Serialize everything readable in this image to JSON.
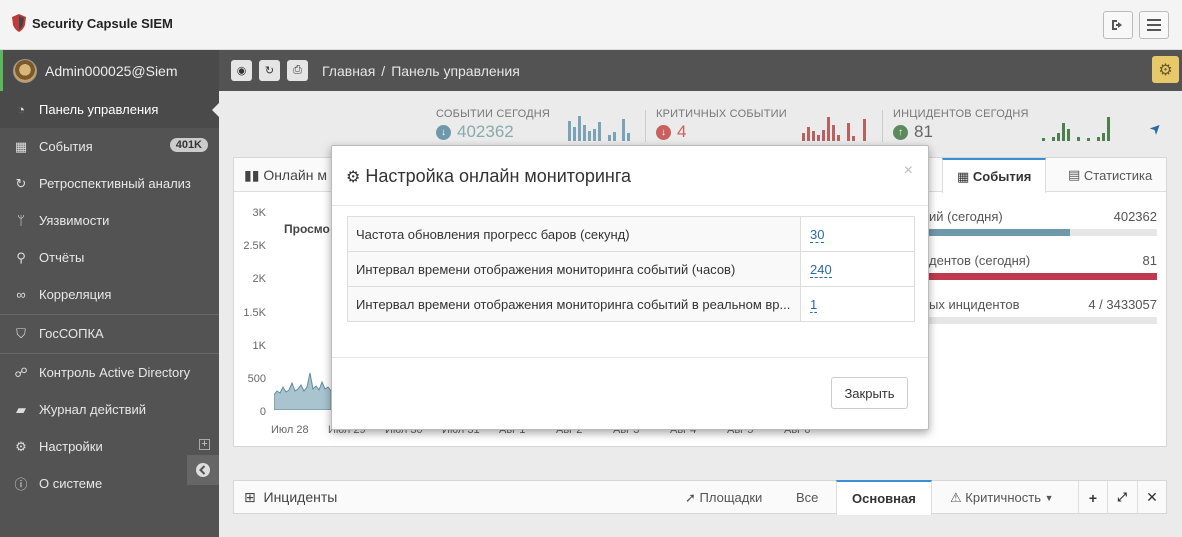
{
  "app": {
    "title": "Security Capsule SIEM"
  },
  "user": {
    "name": "Admin000025@Siem"
  },
  "sidebar": {
    "items": [
      {
        "label": "Панель управления",
        "icon": "dashboard-icon"
      },
      {
        "label": "События",
        "icon": "calendar-icon",
        "badge": "401K"
      },
      {
        "label": "Ретроспективный анализ",
        "icon": "refresh-icon"
      },
      {
        "label": "Уязвимости",
        "icon": "branch-icon"
      },
      {
        "label": "Отчёты",
        "icon": "search-icon"
      },
      {
        "label": "Корреляция",
        "icon": "link-icon"
      },
      {
        "label": "ГосСОПКА",
        "icon": "shield-icon"
      },
      {
        "label": "Контроль Active Directory",
        "icon": "sitemap-icon"
      },
      {
        "label": "Журнал действий",
        "icon": "book-icon"
      },
      {
        "label": "Настройки",
        "icon": "gear-icon"
      },
      {
        "label": "О системе",
        "icon": "info-icon"
      }
    ]
  },
  "breadcrumb": {
    "home": "Главная",
    "current": "Панель управления"
  },
  "stats": [
    {
      "label": "СОБЫТИИ СЕГОДНЯ",
      "value": "402362",
      "color": "#7aa3b8"
    },
    {
      "label": "КРИТИЧНЫХ СОБЫТИИ",
      "value": "4",
      "color": "#c9605e"
    },
    {
      "label": "ИНЦИДЕНТОВ СЕГОДНЯ",
      "value": "81",
      "color": "#5c8a5c"
    }
  ],
  "panel": {
    "title": "Онлайн м",
    "tabs": [
      "События",
      "Статистика"
    ],
    "chart_heading": "Просмо"
  },
  "chart_data": {
    "type": "area",
    "y_ticks": [
      "3K",
      "2.5K",
      "2K",
      "1.5K",
      "1K",
      "500",
      "0"
    ],
    "x_ticks": [
      "Июл 28",
      "Июл 29",
      "Июл 30",
      "Июл 31",
      "Авг 1",
      "Авг 2",
      "Авг 3",
      "Авг 4",
      "Авг 5",
      "Авг 6"
    ],
    "ylim": [
      0,
      3000
    ]
  },
  "right_stats": [
    {
      "label": "ий (сегодня)",
      "value": "402362",
      "fill": 0.62,
      "color": "#6f98ab"
    },
    {
      "label": "дентов (сегодня)",
      "value": "81",
      "fill": 1.0,
      "color": "#c03a4f"
    },
    {
      "label": "ых инцидентов",
      "value": "4 / 3433057",
      "fill": 0.0,
      "color": "#999999"
    }
  ],
  "incidents": {
    "title": "Инциденты",
    "platforms": "Площадки",
    "all": "Все",
    "main": "Основная",
    "criticality": "Критичность"
  },
  "modal": {
    "title": "Настройка онлайн мониторинга",
    "rows": [
      {
        "label": "Частота обновления прогресс баров (секунд)",
        "value": "30"
      },
      {
        "label": "Интервал времени отображения мониторинга событий (часов)",
        "value": "240"
      },
      {
        "label": "Интервал времени отображения мониторинга событий в реальном вр...",
        "value": "1"
      }
    ],
    "close_label": "Закрыть",
    "close_x": "×"
  }
}
